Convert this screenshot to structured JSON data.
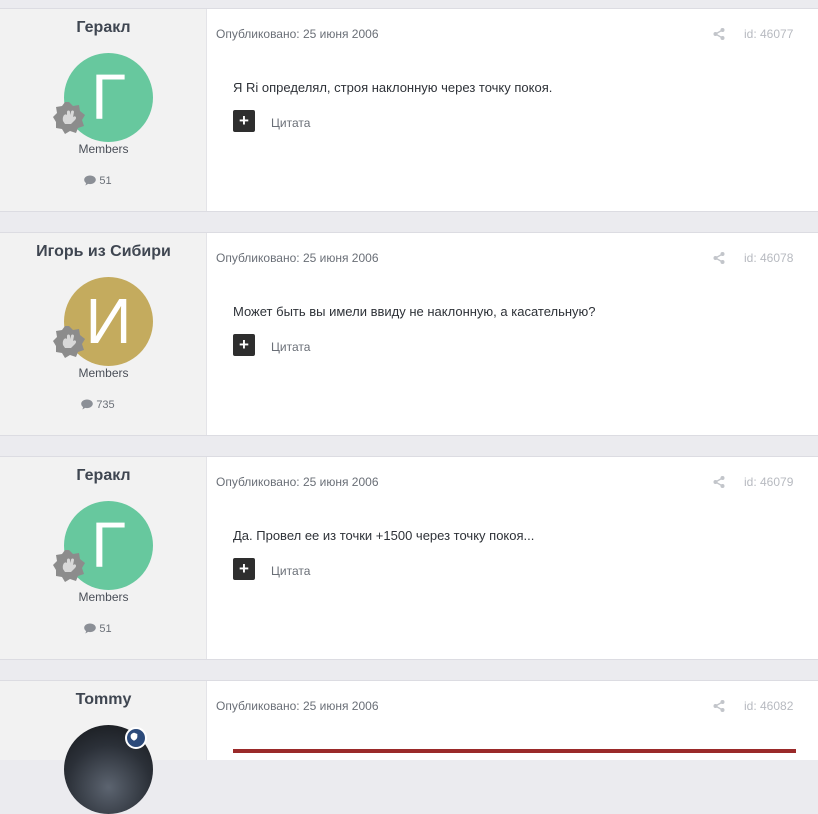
{
  "labels": {
    "published_prefix": "Опубликовано:",
    "quote": "Цитата",
    "quote_plus": "+"
  },
  "posts": [
    {
      "author": "Геракл",
      "avatar_letter": "Г",
      "avatar_color": "#67c89e",
      "group": "Members",
      "post_count": "51",
      "date": "Опубликовано: 25 июня 2006",
      "post_id": "id: 46077",
      "text": "Я Ri определял, строя наклонную через точку покоя."
    },
    {
      "author": "Игорь из Сибири",
      "avatar_letter": "И",
      "avatar_color": "#c4ab5e",
      "group": "Members",
      "post_count": "735",
      "date": "Опубликовано: 25 июня 2006",
      "post_id": "id: 46078",
      "text": "Может быть вы имели ввиду не наклонную, а касательную?"
    },
    {
      "author": "Геракл",
      "avatar_letter": "Г",
      "avatar_color": "#67c89e",
      "group": "Members",
      "post_count": "51",
      "date": "Опубликовано: 25 июня 2006",
      "post_id": "id: 46079",
      "text": "Да. Провел ее из точки +1500 через точку покоя..."
    },
    {
      "author": "Tommy",
      "date": "Опубликовано: 25 июня 2006",
      "post_id": "id: 46082"
    }
  ],
  "colors": {
    "rank_badge": "#8c8c8c",
    "moderator_badge": "#2c4a7a",
    "quote_bar": "#9a2a2a"
  }
}
